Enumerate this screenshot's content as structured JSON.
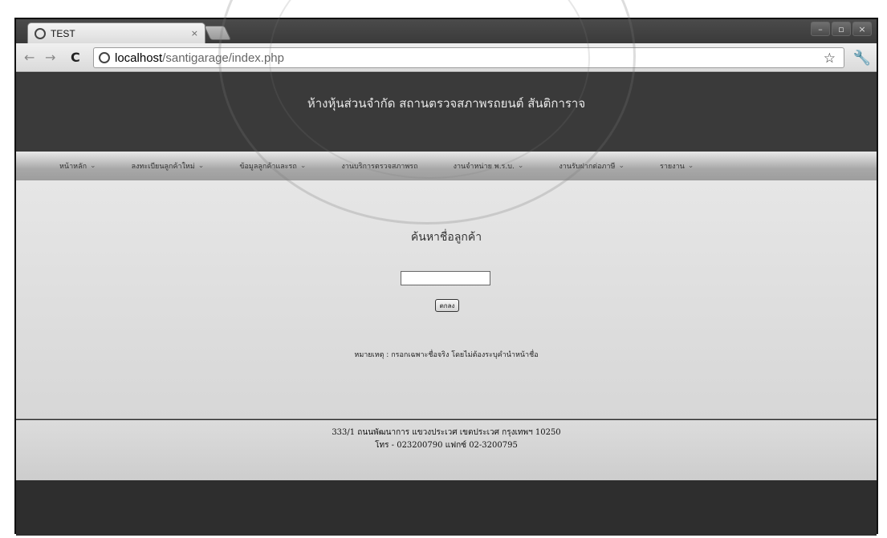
{
  "browser": {
    "tab_title": "TEST",
    "tab_close": "×",
    "url_host": "localhost",
    "url_path": "/santigarage/index.php",
    "window_controls": [
      "–",
      "▫",
      "×"
    ]
  },
  "site": {
    "title": "ห้างหุ้นส่วนจำกัด สถานตรวจสภาพรถยนต์ สันติการาจ",
    "menu": [
      {
        "label": "หน้าหลัก"
      },
      {
        "label": "ลงทะเบียนลูกค้าใหม่"
      },
      {
        "label": "ข้อมูลลูกค้าและรถ"
      },
      {
        "label": "งานบริการตรวจสภาพรถ"
      },
      {
        "label": "งานจำหน่าย พ.ร.บ."
      },
      {
        "label": "งานรับฝากต่อภาษี"
      },
      {
        "label": "รายงาน"
      }
    ]
  },
  "search": {
    "title": "ค้นหาชื่อลูกค้า",
    "input_value": "",
    "button_label": "ตกลง",
    "note": "หมายเหตุ : กรอกเฉพาะชื่อจริง โดยไม่ต้องระบุคำนำหน้าชื่อ"
  },
  "footer": {
    "address": "333/1  ถนนพัฒนาการ  แขวงประเวศ  เขตประเวศ  กรุงเทพฯ 10250",
    "contact": "โทร - 023200790    แฟกซ์ 02-3200795"
  }
}
